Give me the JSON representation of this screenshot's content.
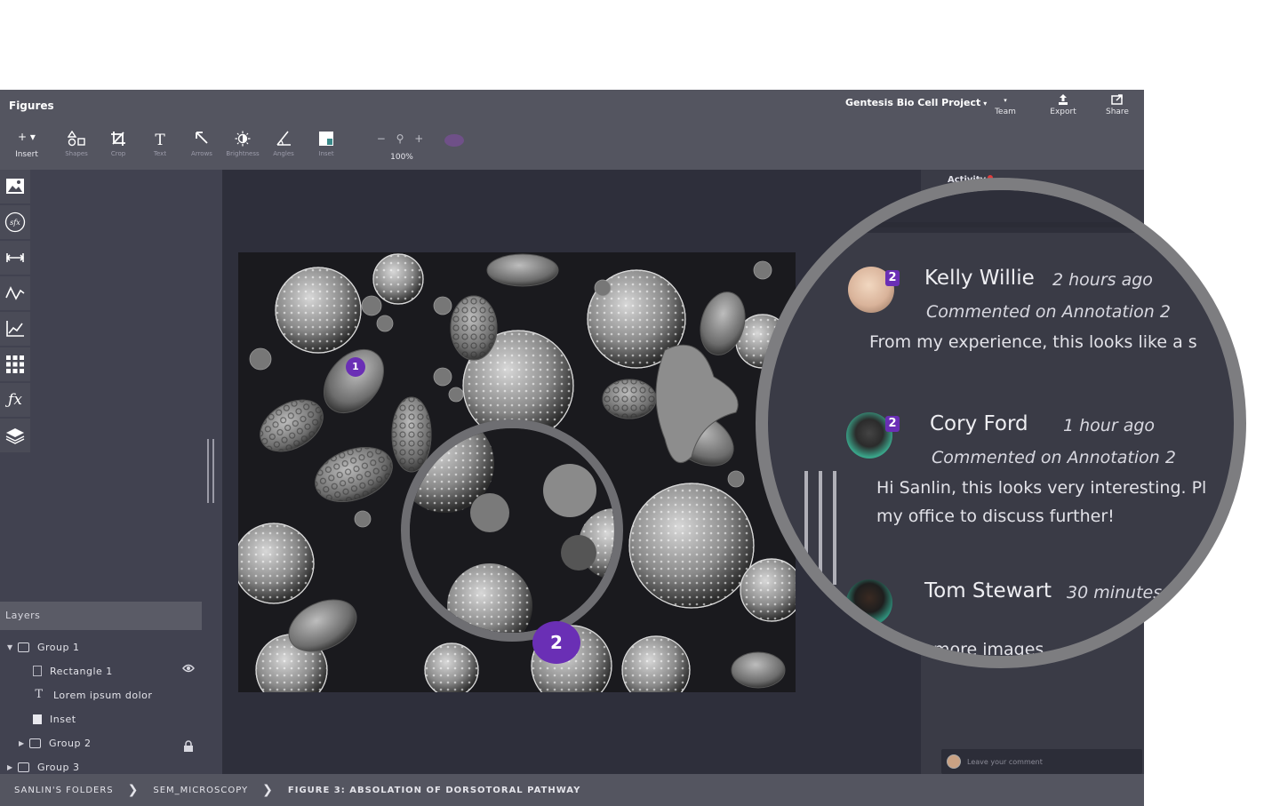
{
  "app_title": "Figures",
  "project": {
    "name": "Gentesis Bio Cell Project",
    "caret": "▾"
  },
  "top_actions": [
    {
      "label": "Team",
      "icon": "team-dropdown-icon"
    },
    {
      "label": "Export",
      "icon": "export-icon"
    },
    {
      "label": "Share",
      "icon": "share-icon"
    }
  ],
  "insert": {
    "label": "Insert",
    "icon": "+ ▾"
  },
  "tools": [
    {
      "label": "Shapes",
      "icon": "shapes-icon"
    },
    {
      "label": "Crop",
      "icon": "crop-icon"
    },
    {
      "label": "Text",
      "icon": "text-icon"
    },
    {
      "label": "Arrows",
      "icon": "arrow-icon"
    },
    {
      "label": "Brightness",
      "icon": "brightness-icon"
    },
    {
      "label": "Angles",
      "icon": "angle-icon"
    },
    {
      "label": "Inset",
      "icon": "inset-icon"
    }
  ],
  "zoom": {
    "minus": "−",
    "plus": "+",
    "value": "100%"
  },
  "rail_icons": [
    "image-icon",
    "sfx-icon",
    "measure-icon",
    "line-graph-icon",
    "chart-icon",
    "grid-icon",
    "function-icon",
    "layers-icon"
  ],
  "layers": {
    "title": "Layers",
    "items": [
      {
        "label": "Group 1",
        "type": "group",
        "expanded": true
      },
      {
        "label": "Rectangle 1",
        "type": "rectangle",
        "visible_icon": "eye-icon"
      },
      {
        "label": "Lorem ipsum dolor",
        "type": "text"
      },
      {
        "label": "Inset",
        "type": "inset"
      },
      {
        "label": "Group 2",
        "type": "group",
        "locked_icon": "lock-icon"
      },
      {
        "label": "Group 3",
        "type": "group"
      }
    ]
  },
  "annotations": {
    "marker1": "1",
    "marker2": "2"
  },
  "activity": {
    "title": "Activity"
  },
  "comments": [
    {
      "name": "Kelly Willie",
      "time": "2 hours ago",
      "subtitle": "Commented on Annotation 2",
      "text": "From my experience, this looks like a s",
      "badge": "2",
      "avatar_color": "#d9b39a"
    },
    {
      "name": "Cory Ford",
      "time": "1 hour ago",
      "subtitle": "Commented on Annotation 2",
      "text": "Hi Sanlin, this looks very interesting. Pl",
      "text2": "my office to discuss further!",
      "badge": "2",
      "avatar_color": "#3aa58a"
    },
    {
      "name": "Tom Stewart",
      "time": "30 minutes",
      "text": "more images",
      "avatar_color": "#2f8e7a"
    }
  ],
  "comment_input": {
    "placeholder": "Leave your comment"
  },
  "breadcrumb": [
    "SANLIN'S FOLDERS",
    "SEM_MICROSCOPY",
    "FIGURE 3: ABSOLATION OF DORSOTORAL PATHWAY"
  ],
  "breadcrumb_sep": "❯"
}
